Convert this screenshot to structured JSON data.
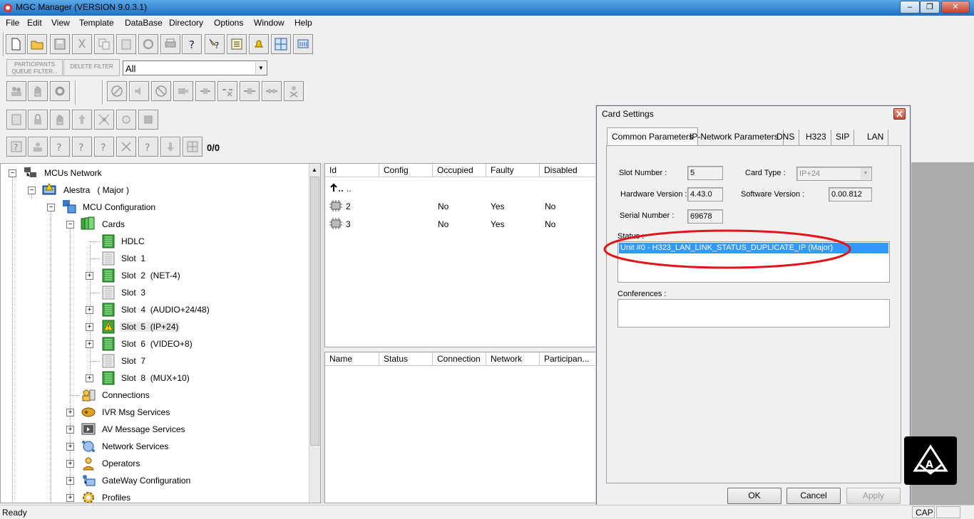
{
  "window": {
    "title": "MGC Manager (VERSION 9.0.3.1)"
  },
  "menu": [
    "File",
    "Edit",
    "View",
    "Template",
    "DataBase",
    "Directory",
    "Options",
    "Window",
    "Help"
  ],
  "filter": {
    "participants_queue_label_1": "PARTICIPANTS",
    "participants_queue_label_2": "QUEUE FILTER...",
    "delete_filter_label": "DELETE FILTER",
    "combo_value": "All"
  },
  "counter": "0/0",
  "tree": {
    "root": "MCUs Network",
    "mcu": "Alestra   ( Major )",
    "mcu_config": "MCU Configuration",
    "cards": "Cards",
    "card_items": [
      "HDLC",
      "Slot  1",
      "Slot  2  (NET-4)",
      "Slot  3",
      "Slot  4  (AUDIO+24/48)",
      "Slot  5  (IP+24)",
      "Slot  6  (VIDEO+8)",
      "Slot  7",
      "Slot  8  (MUX+10)"
    ],
    "services": [
      "Connections",
      "IVR Msg Services",
      "AV Message Services",
      "Network Services",
      "Operators",
      "GateWay Configuration",
      "Profiles"
    ]
  },
  "units_table": {
    "columns": [
      "Id",
      "Config",
      "Occupied",
      "Faulty",
      "Disabled"
    ],
    "up_label": "..",
    "rows": [
      {
        "id": "2",
        "occupied": "No",
        "faulty": "Yes",
        "disabled": "No"
      },
      {
        "id": "3",
        "occupied": "No",
        "faulty": "Yes",
        "disabled": "No"
      }
    ]
  },
  "conf_table": {
    "columns": [
      "Name",
      "Status",
      "Connection",
      "Network",
      "Participan..."
    ]
  },
  "dialog": {
    "title": "Card Settings",
    "tabs": [
      "Common Parameters",
      "IP-Network Parameters",
      "DNS",
      "H323",
      "SIP",
      "LAN"
    ],
    "slot_number_label": "Slot Number :",
    "slot_number": "5",
    "card_type_label": "Card Type :",
    "card_type": "IP+24",
    "hardware_version_label": "Hardware Version :",
    "hardware_version": "4.43.0",
    "software_version_label": "Software Version :",
    "software_version": "0.00.812",
    "serial_number_label": "Serial Number :",
    "serial_number": "69678",
    "status_label": "Status :",
    "status_item": "Unit #0 - H323_LAN_LINK_STATUS_DUPLICATE_IP (Major)",
    "conferences_label": "Conferences :",
    "ok_label": "OK",
    "cancel_label": "Cancel",
    "apply_label": "Apply"
  },
  "statusbar": {
    "left": "Ready",
    "cap": "CAP"
  },
  "colors": {
    "highlight": "#3399ff",
    "annotation": "#e0161b",
    "card_green": "#3aa83a"
  }
}
